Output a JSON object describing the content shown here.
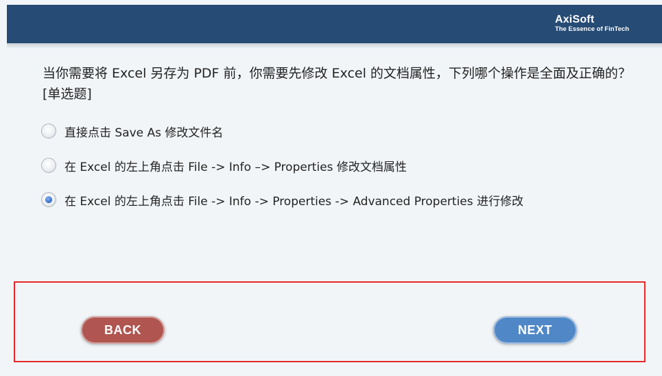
{
  "header": {
    "brand": "AxiSoft",
    "tagline": "The Essence of FinTech"
  },
  "question": {
    "text": "当你需要将 Excel 另存为 PDF 前，你需要先修改 Excel 的文档属性，下列哪个操作是全面及正确的？[单选题]"
  },
  "options": [
    {
      "label": "直接点击 Save As 修改文件名",
      "selected": false
    },
    {
      "label": "在 Excel 的左上角点击 File -> Info –> Properties 修改文档属性",
      "selected": false
    },
    {
      "label": "在 Excel 的左上角点击 File -> Info -> Properties -> Advanced Properties 进行修改",
      "selected": true
    }
  ],
  "nav": {
    "back_label": "BACK",
    "next_label": "NEXT"
  },
  "colors": {
    "header_bg": "#264b74",
    "back_button": "#b0554f",
    "next_button": "#4f87c7",
    "highlight_border": "#e5262a"
  }
}
